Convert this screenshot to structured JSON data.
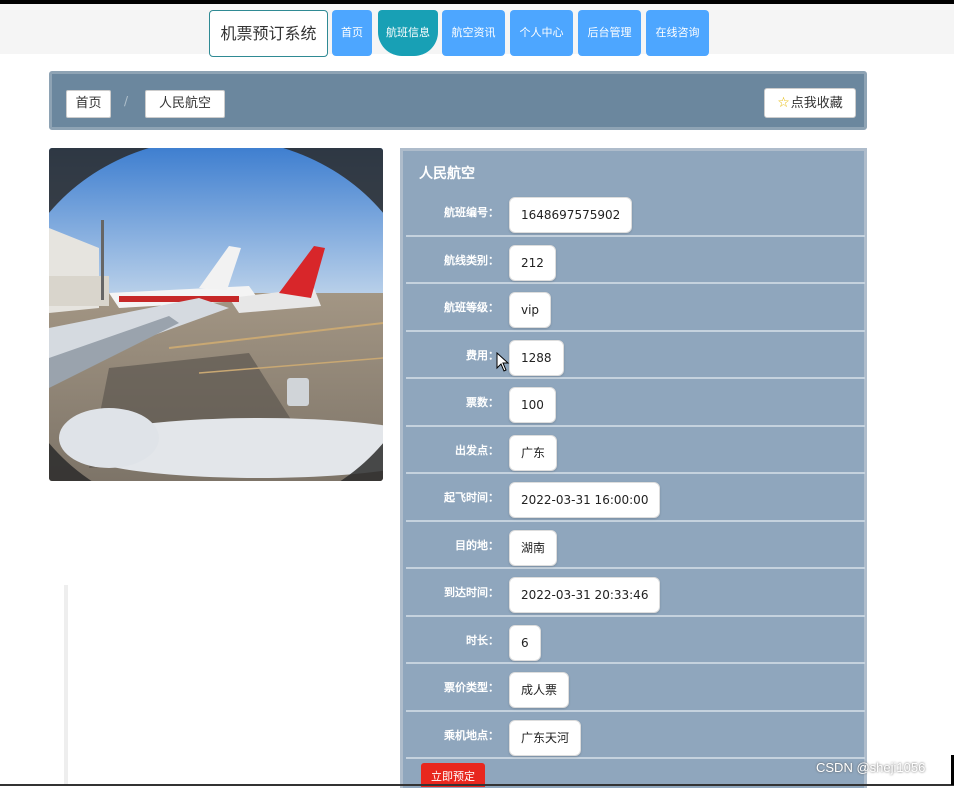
{
  "nav": {
    "brand": "机票预订系统",
    "items": [
      {
        "label": "首页"
      },
      {
        "label": "航班信息"
      },
      {
        "label": "航空资讯"
      },
      {
        "label": "个人中心"
      },
      {
        "label": "后台管理"
      },
      {
        "label": "在线咨询"
      }
    ],
    "active_index": 1
  },
  "breadcrumb": {
    "home": "首页",
    "separator": "/",
    "current": "人民航空"
  },
  "favorite_button": {
    "label": "点我收藏",
    "icon": "star-icon"
  },
  "photo": {
    "alt": "airport-window-view"
  },
  "detail": {
    "title": "人民航空",
    "fields": [
      {
        "label": "航班编号：",
        "value": "1648697575902"
      },
      {
        "label": "航线类别：",
        "value": "212"
      },
      {
        "label": "航班等级：",
        "value": "vip"
      },
      {
        "label": "费用：",
        "value": "1288"
      },
      {
        "label": "票数：",
        "value": "100"
      },
      {
        "label": "出发点：",
        "value": "广东"
      },
      {
        "label": "起飞时间：",
        "value": "2022-03-31 16:00:00"
      },
      {
        "label": "目的地：",
        "value": "湖南"
      },
      {
        "label": "到达时间：",
        "value": "2022-03-31 20:33:46"
      },
      {
        "label": "时长：",
        "value": "6"
      },
      {
        "label": "票价类型：",
        "value": "成人票"
      },
      {
        "label": "乘机地点：",
        "value": "广东天河"
      }
    ],
    "book_button": "立即预定"
  },
  "watermark": "CSDN @sheji1056",
  "colors": {
    "nav_button": "#4da6ff",
    "nav_active": "#18a0b5",
    "panel_bg": "#8fa6bd",
    "crumb_bar": "#6b879e",
    "book_button": "#e8271e"
  }
}
